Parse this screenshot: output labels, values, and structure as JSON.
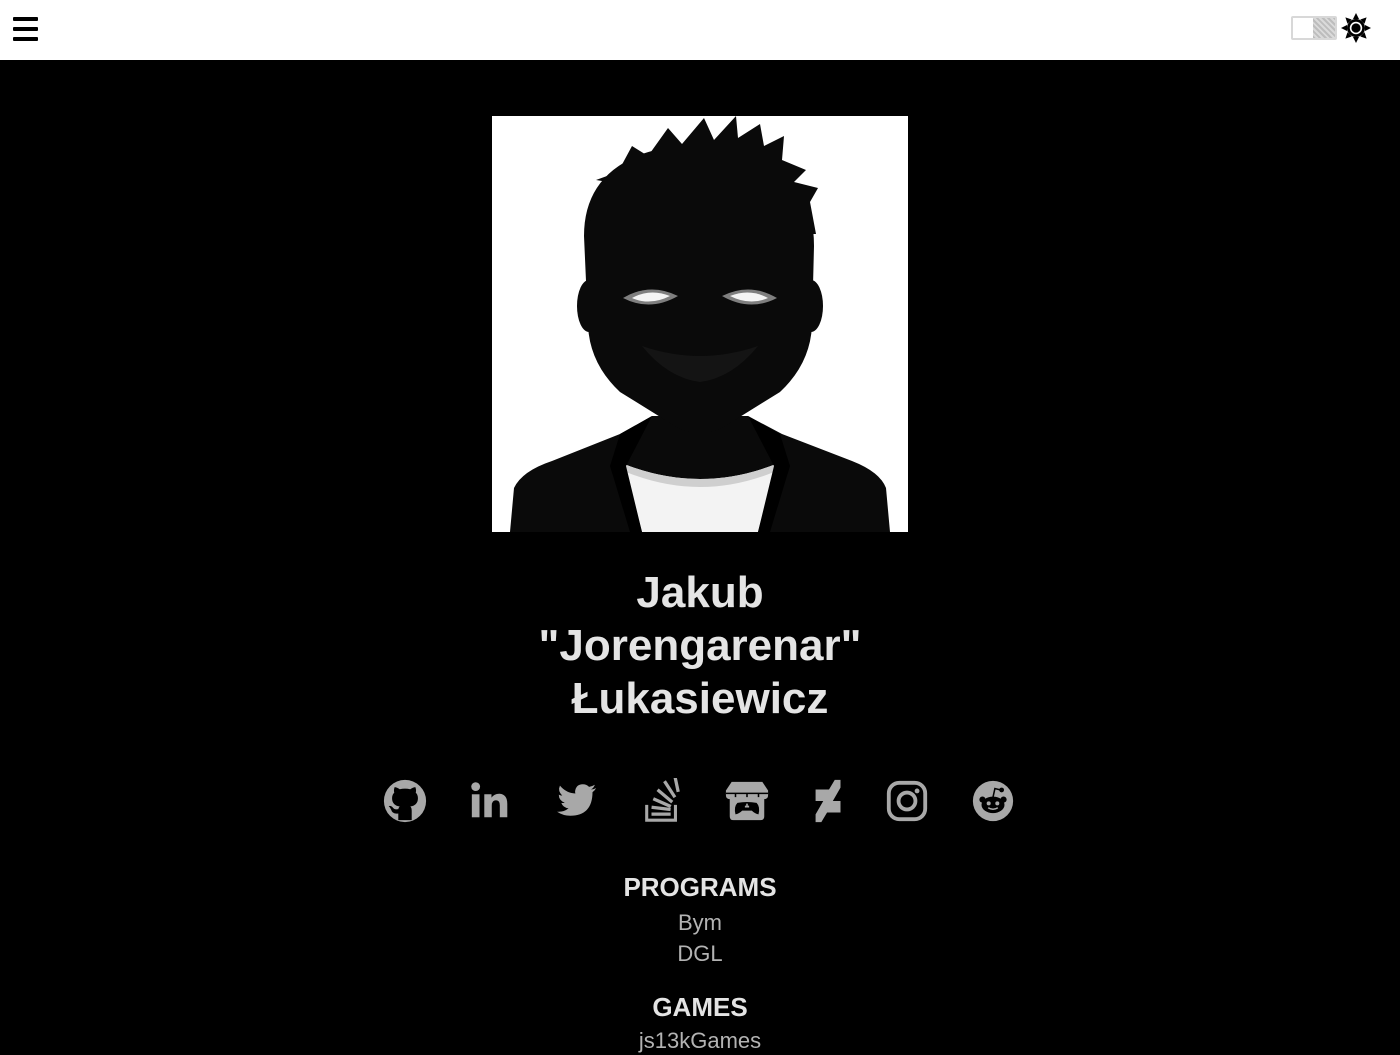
{
  "header": {
    "menu_icon": "hamburger-menu-icon",
    "theme_icon": "sun-icon"
  },
  "profile": {
    "name_line1": "Jakub",
    "name_line2": "\"Jorengarenar\"",
    "name_line3": "Łukasiewicz"
  },
  "socials": [
    {
      "name": "GitHub",
      "icon": "github-icon"
    },
    {
      "name": "LinkedIn",
      "icon": "linkedin-icon"
    },
    {
      "name": "Twitter",
      "icon": "twitter-icon"
    },
    {
      "name": "Stack Overflow",
      "icon": "stackoverflow-icon"
    },
    {
      "name": "itch.io",
      "icon": "itchio-icon"
    },
    {
      "name": "DeviantArt",
      "icon": "deviantart-icon"
    },
    {
      "name": "Instagram",
      "icon": "instagram-icon"
    },
    {
      "name": "Reddit",
      "icon": "reddit-icon"
    }
  ],
  "sections": {
    "programs": {
      "title": "PROGRAMS",
      "items": [
        "Bym",
        "DGL"
      ]
    },
    "games": {
      "title": "GAMES",
      "items": [
        "js13kGames"
      ]
    }
  },
  "colors": {
    "page_bg": "#000000",
    "header_bg": "#ffffff",
    "heading_text": "#e4e4e4",
    "link_text": "#b3b3b3",
    "icon_color": "#a8a8a8"
  }
}
